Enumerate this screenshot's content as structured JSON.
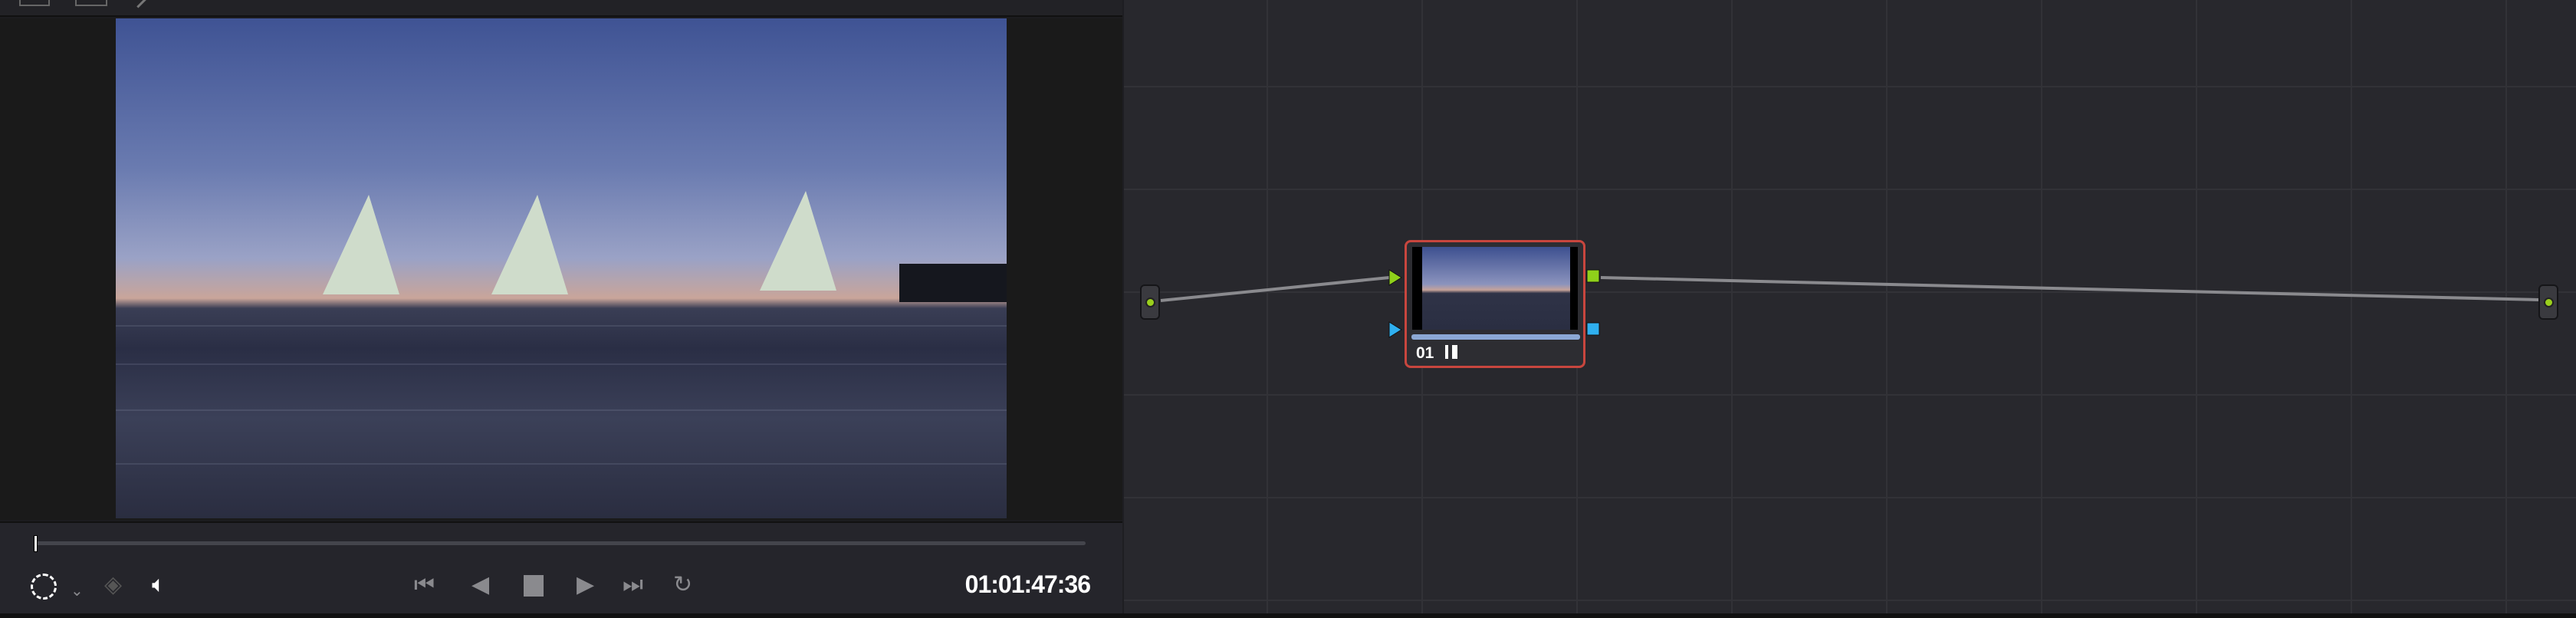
{
  "viewer": {
    "timecode": "01:01:47:36",
    "playhead_fraction": 0.0
  },
  "node_editor": {
    "nodes": [
      {
        "label": "01"
      }
    ]
  },
  "colors": {
    "node_border": "#c8463e",
    "input_rgb": "#8fd11a",
    "input_key": "#2fb0f0",
    "output_dot": "#9bd01c"
  },
  "icons": [
    "viewer-layout-icon",
    "split-view-icon",
    "picker-icon",
    "highlight-icon",
    "layers-icon",
    "speaker-icon",
    "skip-start-icon",
    "reverse-play-icon",
    "stop-icon",
    "play-icon",
    "skip-end-icon",
    "loop-icon",
    "histogram-icon"
  ]
}
